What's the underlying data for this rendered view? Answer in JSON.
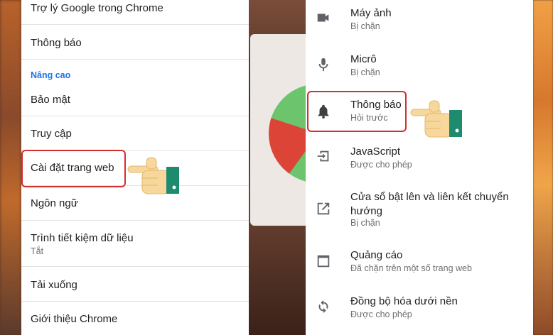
{
  "left_panel": {
    "items": [
      {
        "label": "Trợ lý Google trong Chrome"
      },
      {
        "label": "Thông báo"
      },
      {
        "label": "Bảo mật"
      },
      {
        "label": "Truy cập"
      },
      {
        "label": "Cài đặt trang web"
      },
      {
        "label": "Ngôn ngữ"
      },
      {
        "label": "Trình tiết kiệm dữ liệu",
        "sublabel": "Tắt"
      },
      {
        "label": "Tải xuống"
      },
      {
        "label": "Giới thiệu Chrome"
      }
    ],
    "section_advanced": "Nâng cao"
  },
  "right_panel": {
    "items": [
      {
        "label": "Máy ảnh",
        "status": "Bị chặn",
        "icon": "camera-icon"
      },
      {
        "label": "Micrô",
        "status": "Bị chặn",
        "icon": "microphone-icon"
      },
      {
        "label": "Thông báo",
        "status": "Hỏi trước",
        "icon": "bell-icon"
      },
      {
        "label": "JavaScript",
        "status": "Được cho phép",
        "icon": "javascript-icon"
      },
      {
        "label": "Cửa sổ bật lên và liên kết chuyển hướng",
        "status": "Bị chặn",
        "icon": "popup-redirect-icon"
      },
      {
        "label": "Quảng cáo",
        "status": "Đã chặn trên một số trang web",
        "icon": "ads-window-icon"
      },
      {
        "label": "Đồng bộ hóa dưới nền",
        "status": "Được cho phép",
        "icon": "sync-icon"
      }
    ]
  },
  "colors": {
    "accent": "#1a73e8",
    "highlight": "#d32f2f",
    "hand_sleeve": "#1e8a6e",
    "hand_skin": "#f7d79b"
  }
}
